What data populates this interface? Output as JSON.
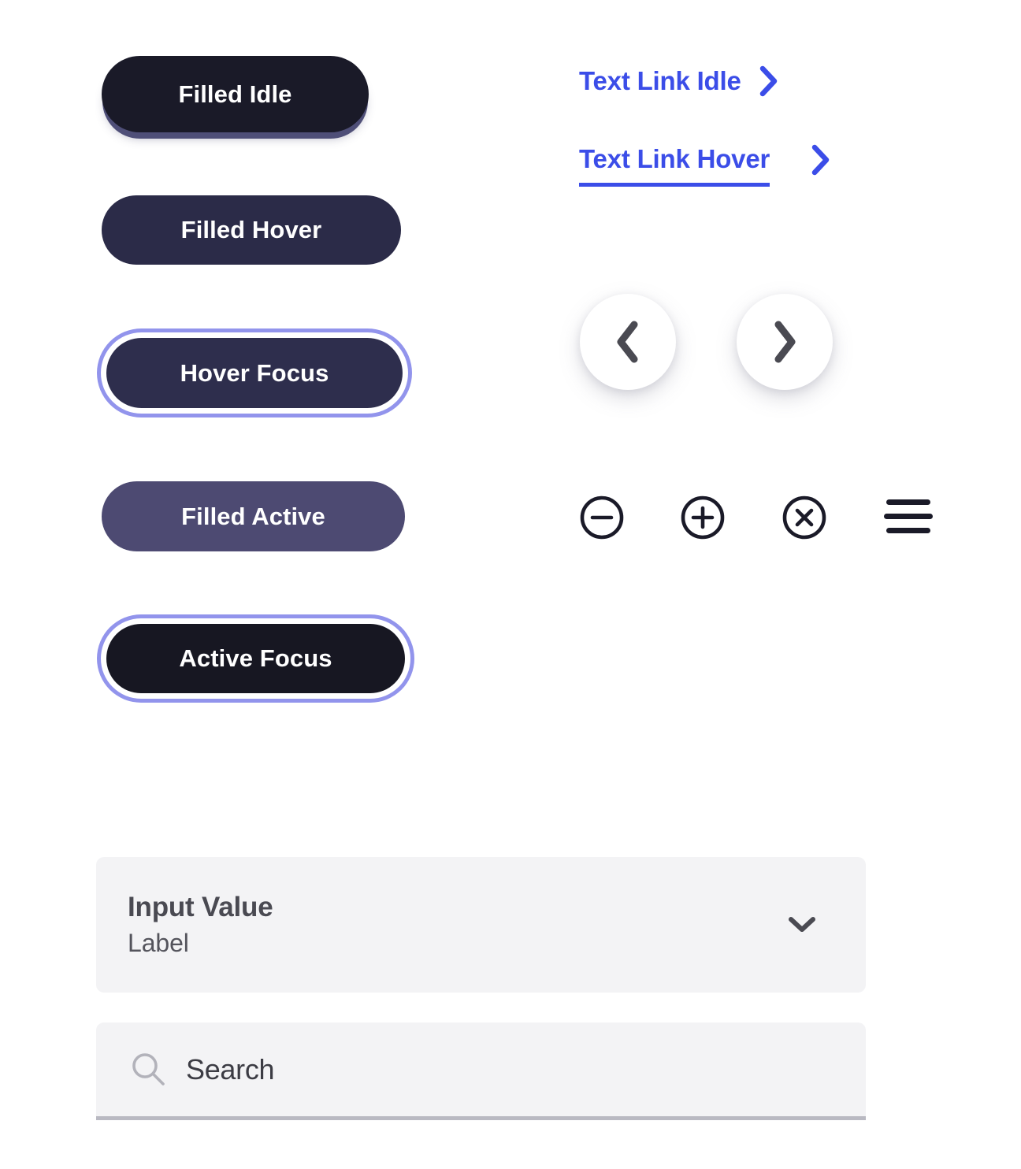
{
  "buttons": [
    {
      "id": "filled-idle",
      "label": "Filled Idle",
      "state": "idle",
      "bg": "#1a1a28",
      "text_color": "#ffffff"
    },
    {
      "id": "filled-hover",
      "label": "Filled Hover",
      "state": "hover",
      "bg": "#2b2b48",
      "text_color": "#ffffff"
    },
    {
      "id": "hover-focus",
      "label": "Hover Focus",
      "state": "hover-focus",
      "bg": "#2e2e4d",
      "text_color": "#ffffff",
      "focus_ring": "#9294ec"
    },
    {
      "id": "filled-active",
      "label": "Filled Active",
      "state": "active",
      "bg": "#4d4a72",
      "text_color": "#ffffff"
    },
    {
      "id": "active-focus",
      "label": "Active Focus",
      "state": "active-focus",
      "bg": "#171722",
      "text_color": "#ffffff",
      "focus_ring": "#9294ec"
    }
  ],
  "links": [
    {
      "id": "text-link-idle",
      "label": "Text Link Idle",
      "state": "idle",
      "color": "#3b4de8",
      "icon": "chevron-right-icon",
      "underlined": false
    },
    {
      "id": "text-link-hover",
      "label": "Text Link Hover",
      "state": "hover",
      "color": "#3b4de8",
      "icon": "chevron-right-icon",
      "underlined": true
    }
  ],
  "carousel": {
    "prev": {
      "icon": "chevron-left-icon",
      "bg": "#ffffff",
      "icon_color": "#4a4a52"
    },
    "next": {
      "icon": "chevron-right-icon",
      "bg": "#ffffff",
      "icon_color": "#4a4a52"
    }
  },
  "icon_row": [
    {
      "id": "minus",
      "icon": "minus-circle-icon",
      "color": "#1a1a28"
    },
    {
      "id": "plus",
      "icon": "plus-circle-icon",
      "color": "#1a1a28"
    },
    {
      "id": "close",
      "icon": "x-circle-icon",
      "color": "#1a1a28"
    },
    {
      "id": "menu",
      "icon": "hamburger-menu-icon",
      "color": "#1a1a28"
    }
  ],
  "select_field": {
    "value": "Input Value",
    "label": "Label",
    "icon": "chevron-down-icon",
    "bg": "#f3f3f5",
    "value_color": "#4a4a52",
    "label_color": "#54545c"
  },
  "search_field": {
    "placeholder": "Search",
    "value": "",
    "icon": "search-icon",
    "bg": "#f3f3f5",
    "underline_color": "#b9b9c2",
    "text_color": "#3c3c44"
  }
}
